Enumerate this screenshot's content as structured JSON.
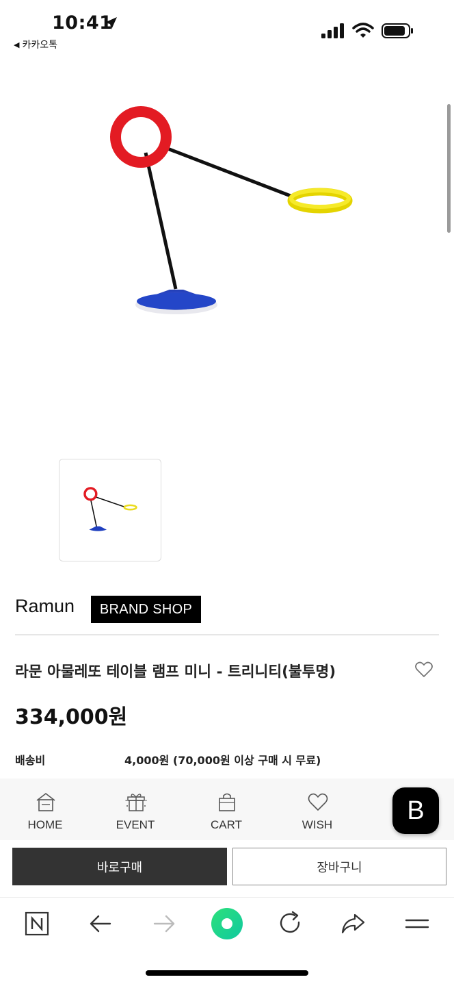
{
  "status_bar": {
    "time": "10:41",
    "back_app": "카카오톡"
  },
  "brand": {
    "name": "Ramun",
    "shop_button": "BRAND SHOP"
  },
  "product": {
    "title": "라문 아물레또 테이블 램프 미니 - 트리니티(불투명)",
    "price": "334,000원",
    "shipping_label": "배송비",
    "shipping_value": "4,000원 (70,000원 이상 구매 시 무료)"
  },
  "shop_nav": {
    "items": [
      {
        "label": "HOME",
        "icon": "home-icon"
      },
      {
        "label": "EVENT",
        "icon": "gift-icon"
      },
      {
        "label": "CART",
        "icon": "shopping-bag-icon"
      },
      {
        "label": "WISH",
        "icon": "heart-icon"
      }
    ],
    "b_button": "B"
  },
  "actions": {
    "buy_now": "바로구매",
    "add_to_cart": "장바구니"
  },
  "colors": {
    "accent_green": "#19d88a",
    "ring_red": "#e31b23",
    "ring_yellow": "#f2e21a",
    "base_blue": "#1f3fbf"
  }
}
